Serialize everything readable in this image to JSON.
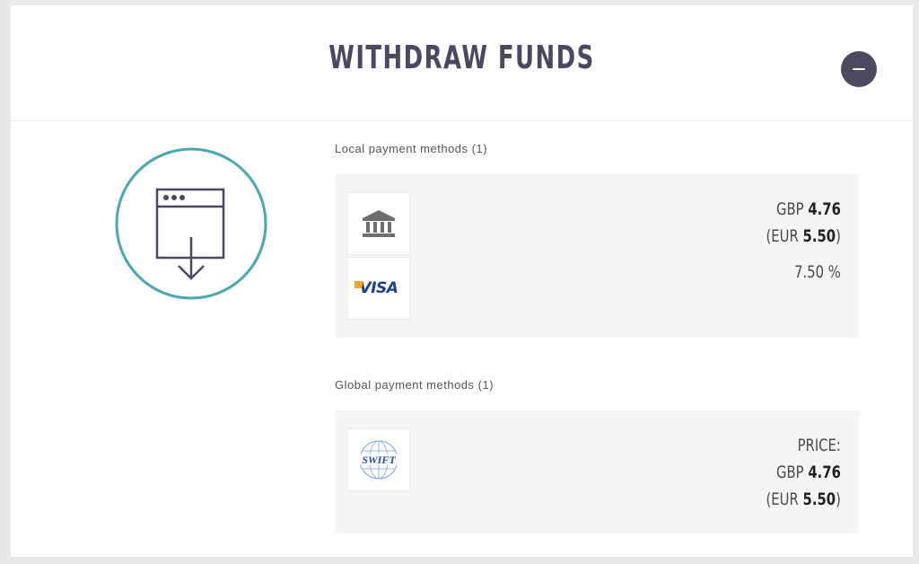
{
  "header": {
    "title": "WITHDRAW FUNDS"
  },
  "local": {
    "label": "Local payment methods (1)",
    "currency": "GBP",
    "amount": "4.76",
    "alt_prefix": "(EUR",
    "alt_amount": "5.50",
    "alt_suffix": ")",
    "fee": "7.50 %",
    "logos": [
      "bank-icon",
      "visa-logo"
    ],
    "visa_text": "VISA"
  },
  "global": {
    "label": "Global payment methods (1)",
    "price_label": "PRICE:",
    "currency": "GBP",
    "amount": "4.76",
    "alt_prefix": "(EUR",
    "alt_amount": "5.50",
    "alt_suffix": ")",
    "logos": [
      "swift-logo"
    ],
    "swift_text": "SWIFT"
  },
  "colors": {
    "accent": "#4e4760",
    "teal": "#4aa9ad",
    "visa_blue": "#1a3f95",
    "visa_gold": "#f5a623"
  }
}
